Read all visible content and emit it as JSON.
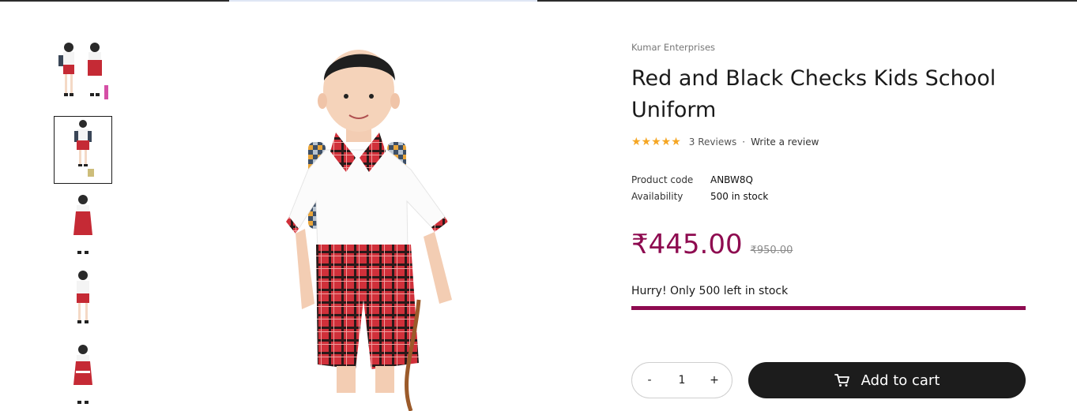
{
  "product": {
    "vendor": "Kumar Enterprises",
    "title": "Red and Black Checks Kids School Uniform",
    "rating": {
      "stars": 5,
      "reviews_label": "3 Reviews",
      "separator": "·",
      "write_review_label": "Write a review"
    },
    "meta": [
      {
        "label": "Product code",
        "value": "ANBW8Q"
      },
      {
        "label": "Availability",
        "value": "500 in stock"
      }
    ],
    "price": "₹445.00",
    "compare_price": "₹950.00",
    "stock_message": "Hurry! Only 500 left in stock",
    "stock_fill_percent": 100,
    "quantity": {
      "minus": "-",
      "value": "1",
      "plus": "+"
    },
    "add_to_cart_label": "Add to cart"
  },
  "gallery": {
    "thumbnails": [
      "pair-of-kids",
      "boy-with-bag",
      "girl-front",
      "boy-front",
      "girl-back"
    ],
    "active_index": 1,
    "main_image": "boy-with-backpack"
  },
  "colors": {
    "accent": "#8e0b50",
    "star": "#f5a623",
    "button_dark": "#1c1c1c"
  }
}
